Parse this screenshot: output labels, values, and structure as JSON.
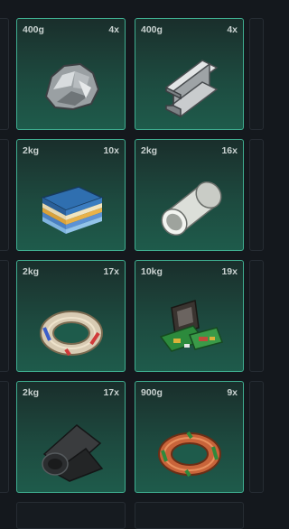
{
  "inventory": {
    "slots": [
      {
        "weight": "400g",
        "quantity": "4x",
        "icon": "stone-icon"
      },
      {
        "weight": "400g",
        "quantity": "4x",
        "icon": "steel-beam-icon"
      },
      {
        "weight": "2kg",
        "quantity": "10x",
        "icon": "fabric-stack-icon"
      },
      {
        "weight": "2kg",
        "quantity": "16x",
        "icon": "pipe-icon"
      },
      {
        "weight": "2kg",
        "quantity": "17x",
        "icon": "wire-coil-icon"
      },
      {
        "weight": "10kg",
        "quantity": "19x",
        "icon": "electronics-icon"
      },
      {
        "weight": "2kg",
        "quantity": "17x",
        "icon": "rubber-roll-icon"
      },
      {
        "weight": "900g",
        "quantity": "9x",
        "icon": "copper-coil-icon"
      }
    ]
  },
  "colors": {
    "background": "#14181d",
    "slot_border": "#3fae90",
    "slot_fill_top": "#1a2e2b",
    "slot_fill_bottom": "#1e5b4b",
    "label_text": "#c9d2d0"
  }
}
